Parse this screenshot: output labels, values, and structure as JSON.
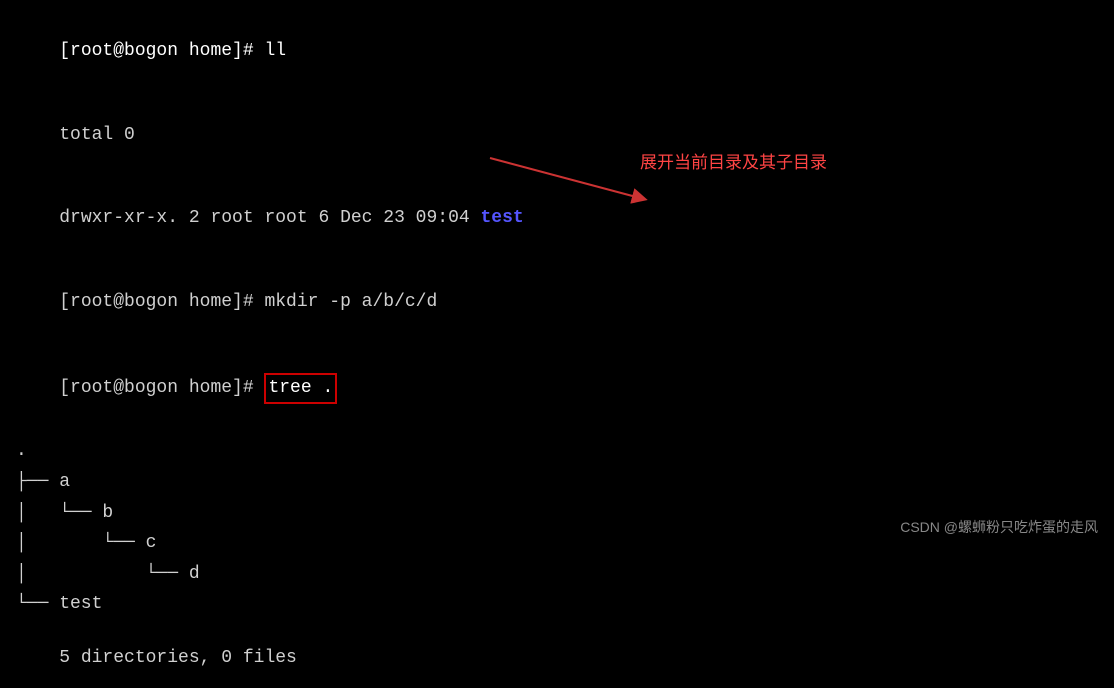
{
  "terminal": {
    "lines": [
      {
        "id": "line1",
        "text": "[root@bogon home]# ll"
      },
      {
        "id": "line2",
        "text": "total 0"
      },
      {
        "id": "line3_prefix",
        "text": "drwxr-xr-x. 2 root root 6 Dec 23 09:04 ",
        "highlight": "test"
      },
      {
        "id": "line4",
        "text": "[root@bogon home]# mkdir -p a/b/c/d"
      },
      {
        "id": "line5_prefix",
        "text": "[root@bogon home]# ",
        "highlight_box": "tree .",
        "suffix": ""
      }
    ],
    "tree_lines": [
      {
        "text": "."
      },
      {
        "text": "├── a"
      },
      {
        "text": "│   └── b"
      },
      {
        "text": "│       └── c"
      },
      {
        "text": "│           └── d"
      },
      {
        "text": "└── test"
      }
    ],
    "summary": "5 directories, 0 files",
    "annotation": {
      "text": "展开当前目录及其子目录"
    }
  },
  "brand": {
    "text": "CSDN @螺蛳粉只吃炸蛋的走风"
  }
}
